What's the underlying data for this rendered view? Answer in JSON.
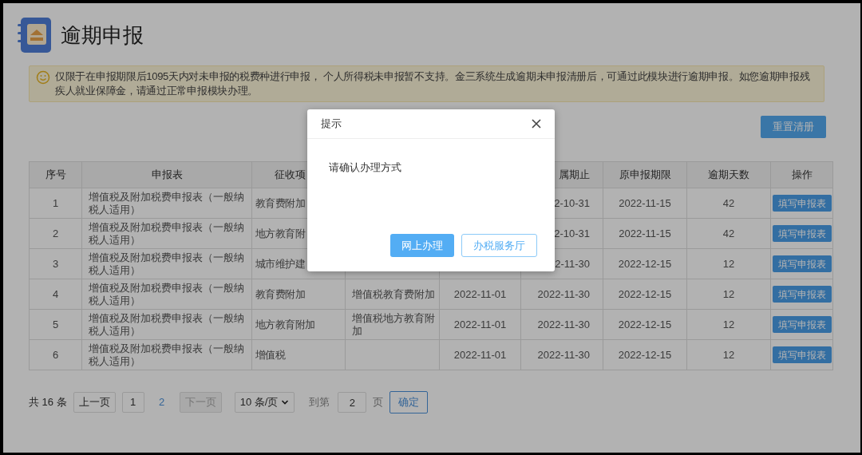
{
  "page": {
    "title": "逾期申报",
    "notice": "仅限于在申报期限后1095天内对未申报的税费种进行申报， 个人所得税未申报暂不支持。金三系统生成逾期未申报清册后，可通过此模块进行逾期申报。如您逾期申报残疾人就业保障金，请通过正常申报模块办理。"
  },
  "reset_button": "重置清册",
  "table": {
    "columns": [
      "序号",
      "申报表",
      "征收项",
      null,
      null,
      "属期止",
      "原申报期限",
      "逾期天数",
      "操作"
    ],
    "rows": [
      [
        "1",
        "增值税及附加税费申报表（一般纳税人适用）",
        "教育费附加",
        null,
        null,
        "2-10-31",
        "2022-11-15",
        "42",
        "填写申报表"
      ],
      [
        "2",
        "增值税及附加税费申报表（一般纳税人适用）",
        "地方教育附",
        null,
        null,
        "2-10-31",
        "2022-11-15",
        "42",
        "填写申报表"
      ],
      [
        "3",
        "增值税及附加税费申报表（一般纳税人适用）",
        "城市维护建",
        null,
        null,
        "2-11-30",
        "2022-12-15",
        "12",
        "填写申报表"
      ],
      [
        "4",
        "增值税及附加税费申报表（一般纳税人适用）",
        "教育费附加",
        "增值税教育费附加",
        "2022-11-01",
        "2022-11-30",
        "2022-12-15",
        "12",
        "填写申报表"
      ],
      [
        "5",
        "增值税及附加税费申报表（一般纳税人适用）",
        "地方教育附加",
        "增值税地方教育附加",
        "2022-11-01",
        "2022-11-30",
        "2022-12-15",
        "12",
        "填写申报表"
      ],
      [
        "6",
        "增值税及附加税费申报表（一般纳税人适用）",
        "增值税",
        null,
        "2022-11-01",
        "2022-11-30",
        "2022-12-15",
        "12",
        "填写申报表"
      ]
    ]
  },
  "pagination": {
    "total": "共 16 条",
    "prev": {
      "label": "上一页",
      "disabled": false
    },
    "pages": [
      {
        "label": "1",
        "selected": false
      },
      {
        "label": "2",
        "selected": true
      }
    ],
    "next": {
      "label": "下一页",
      "disabled": true
    },
    "page_size": "10 条/页",
    "goto_label": "到第",
    "goto_value": "2",
    "goto_suffix": "页",
    "confirm": "确定"
  },
  "modal": {
    "title": "提示",
    "message": "请确认办理方式",
    "buttons": [
      {
        "label": "网上办理",
        "kind": "primary"
      },
      {
        "label": "办税服务厅",
        "kind": "outline"
      }
    ]
  }
}
